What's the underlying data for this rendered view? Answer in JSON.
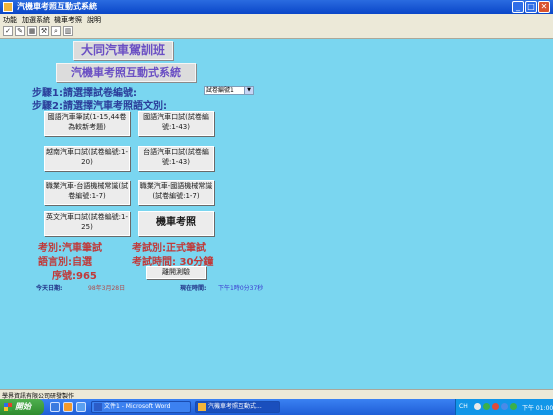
{
  "window": {
    "title": "汽機車考照互動式系統"
  },
  "menu": [
    "功能",
    "加選系統",
    "機車考照",
    "說明"
  ],
  "toolbar": {
    "icons": [
      "check-icon",
      "pen-icon",
      "save-icon",
      "tools-icon",
      "search-icon",
      "chart-icon"
    ],
    "glyphs": [
      "✓",
      "✎",
      "▦",
      "⚒",
      "⌕",
      "▥"
    ]
  },
  "banner": {
    "school": "大同汽車駕訓班",
    "system": "汽機車考照互動式系統"
  },
  "steps": {
    "step1": "步驟1:請選擇試卷編號:",
    "step2": "步驟2:請選擇汽車考照語文別:"
  },
  "paper_select": {
    "value": "試卷編號1"
  },
  "buttons": {
    "mandarin_written": "國語汽車筆試(1-15,44卷為較新考題)",
    "mandarin_oral": "國語汽車口試(試卷編號:1-43)",
    "vietnamese_oral": "越南汽車口試(試卷編號:1-20)",
    "taiwanese_oral": "台語汽車口試(試卷編號:1-43)",
    "pro_taiwanese": "職業汽車-台語機械常識(試卷編號:1-7)",
    "pro_mandarin": "職業汽車-國語機械常識(試卷編號:1-7)",
    "english_oral": "英文汽車口試(試卷編號:1-25)",
    "motorcycle": "機車考照",
    "exit": "離開測驗"
  },
  "status": {
    "exam_category": "考別:汽車筆試",
    "language": "語言別:自選",
    "serial": "序號:965",
    "exam_type": "考試別:正式筆試",
    "exam_time": "考試時間: 30分鐘",
    "date_label": "今天日期:",
    "date_value": "98年3月28日",
    "time_label": "現在時間:",
    "time_value": "下午1時0分37秒"
  },
  "statusbar": {
    "company": "學界資訊有限公司研發製作"
  },
  "taskbar": {
    "start": "開始",
    "tasks": [
      "文件1 - Microsoft Word",
      "汽機車考照互動式..."
    ],
    "tray_lang": "CH",
    "clock": "下午 01:00"
  }
}
